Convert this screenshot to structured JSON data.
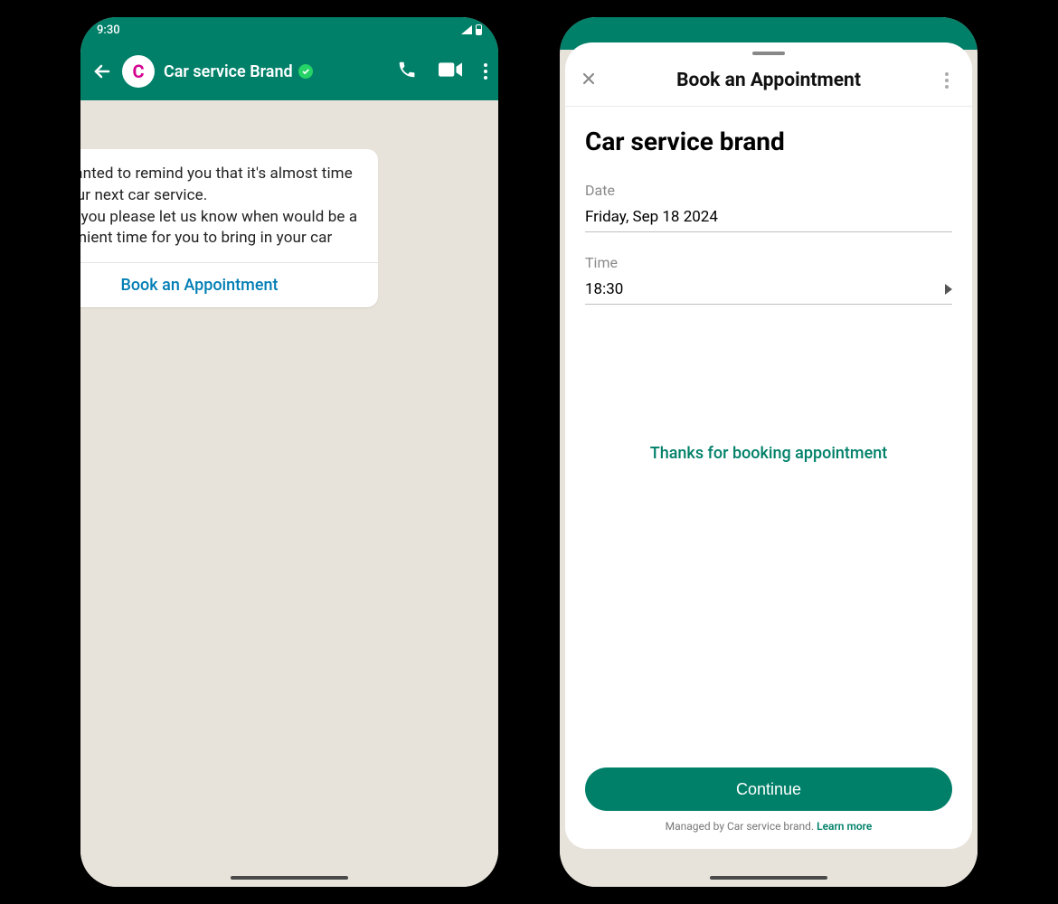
{
  "left": {
    "status_time": "9:30",
    "avatar_letter": "C",
    "chat_title": "Car service Brand",
    "message_text": "We wanted to remind you that it's almost time for your next car service.\nCould you please let us know when would be a convenient time for you to bring in your car",
    "cta_label": "Book an Appointment"
  },
  "right": {
    "sheet_title": "Book an Appointment",
    "brand_title": "Car service brand",
    "date_label": "Date",
    "date_value": "Friday, Sep 18 2024",
    "time_label": "Time",
    "time_value": "18:30",
    "confirmation": "Thanks for booking appointment",
    "continue_label": "Continue",
    "managed_prefix": "Managed by Car service brand. ",
    "learn_more": "Learn more"
  }
}
